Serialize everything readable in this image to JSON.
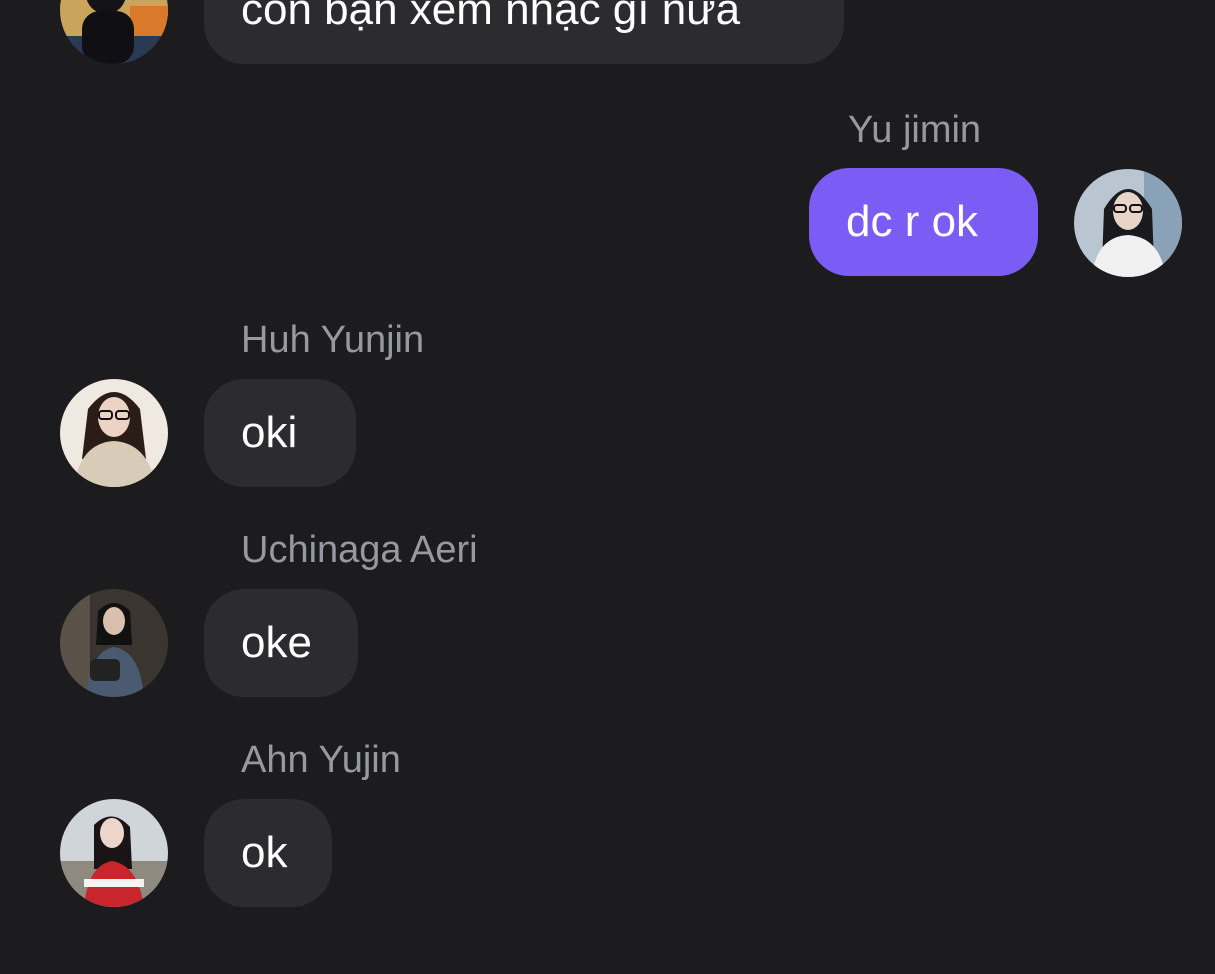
{
  "colors": {
    "background": "#1c1c1e",
    "incoming_bubble": "#2c2c2e",
    "outgoing_bubble": "#7b5cf5",
    "sender_name": "#98989f",
    "message_text": "#ffffff"
  },
  "messages": [
    {
      "direction": "incoming",
      "sender": "",
      "text": "còn bạn xem nhạc gì nữa",
      "avatar": "profile-photo"
    },
    {
      "direction": "outgoing",
      "sender": "Yu jimin",
      "text": "dc r ok",
      "avatar": "profile-photo"
    },
    {
      "direction": "incoming",
      "sender": "Huh Yunjin",
      "text": "oki",
      "avatar": "profile-photo"
    },
    {
      "direction": "incoming",
      "sender": "Uchinaga Aeri",
      "text": "oke",
      "avatar": "profile-photo"
    },
    {
      "direction": "incoming",
      "sender": "Ahn Yujin",
      "text": "ok",
      "avatar": "profile-photo"
    }
  ]
}
